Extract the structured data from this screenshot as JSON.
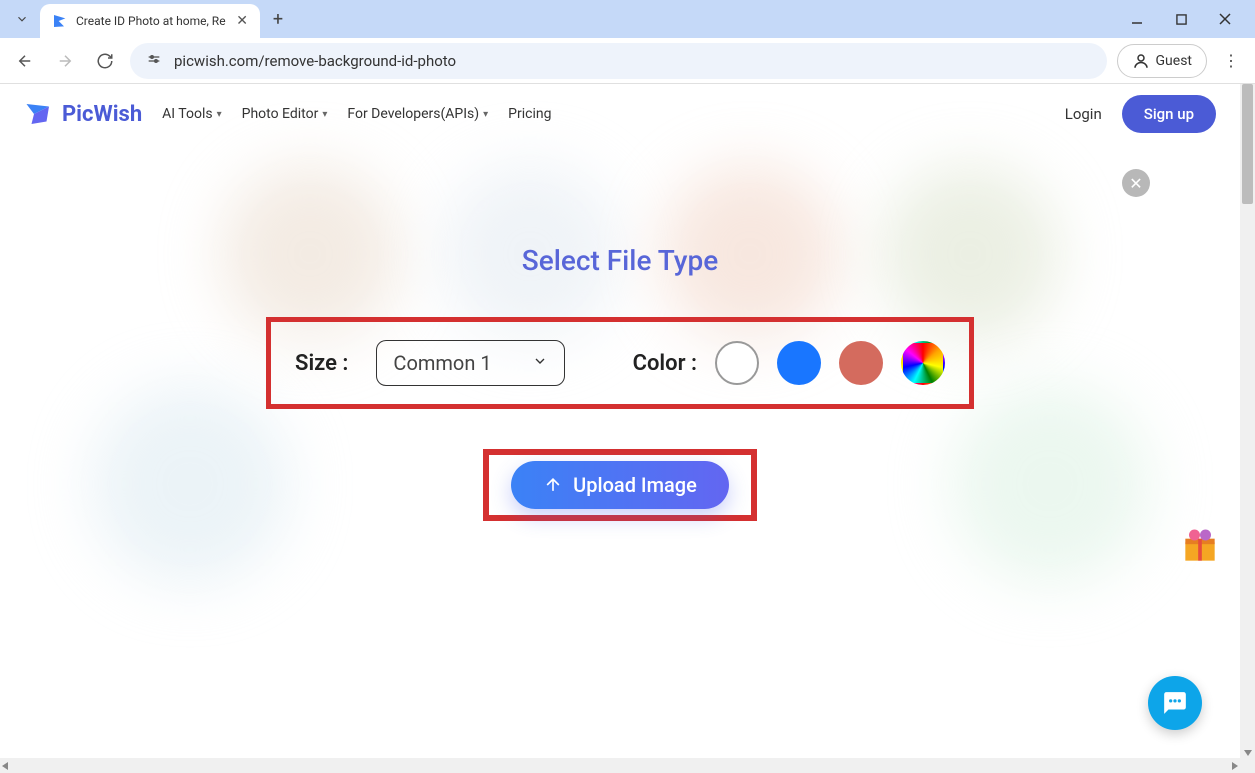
{
  "browser": {
    "tab_title": "Create ID Photo at home, Re",
    "url": "picwish.com/remove-background-id-photo",
    "guest_label": "Guest"
  },
  "header": {
    "logo_text": "PicWish",
    "nav": {
      "ai_tools": "AI Tools",
      "photo_editor": "Photo Editor",
      "developers": "For Developers(APIs)",
      "pricing": "Pricing"
    },
    "login": "Login",
    "signup": "Sign up"
  },
  "modal": {
    "title": "Select File Type",
    "size_label": "Size :",
    "size_value": "Common 1",
    "color_label": "Color :",
    "colors": [
      "white",
      "blue",
      "red",
      "rainbow"
    ],
    "upload_label": "Upload Image"
  }
}
